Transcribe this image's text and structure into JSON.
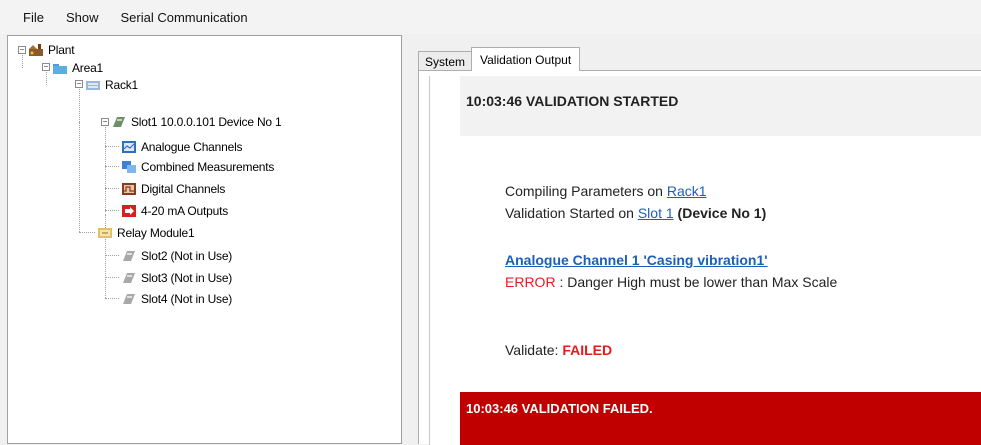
{
  "menu": {
    "file": "File",
    "show": "Show",
    "serial": "Serial Communication"
  },
  "tree": {
    "plant": "Plant",
    "area": "Area1",
    "rack": "Rack1",
    "slot1": "Slot1 10.0.0.101 Device No 1",
    "analogue": "Analogue Channels",
    "combined": "Combined Measurements",
    "digital": "Digital Channels",
    "outputs": "4-20 mA Outputs",
    "relay": "Relay Module1",
    "slot2": "Slot2 (Not in Use)",
    "slot3": "Slot3 (Not in Use)",
    "slot4": "Slot4 (Not in Use)"
  },
  "tabs": {
    "system": "System",
    "validation": "Validation Output"
  },
  "output": {
    "header": "10:03:46 VALIDATION STARTED",
    "compiling_prefix": "Compiling Parameters on ",
    "compiling_link": "Rack1",
    "started_prefix": "Validation Started on ",
    "started_link": "Slot 1",
    "started_suffix": " (Device No 1)",
    "channel_link": "Analogue Channel 1 'Casing vibration1'",
    "error_label": "ERROR",
    "error_sep": " : ",
    "error_text": "Danger High must be lower than Max Scale",
    "validate_label": "Validate: ",
    "validate_value": "FAILED",
    "footer": "10:03:46 VALIDATION FAILED."
  },
  "colors": {
    "error": "#e81b1b",
    "link": "#1c5fb8",
    "fail_band": "#c00000"
  }
}
